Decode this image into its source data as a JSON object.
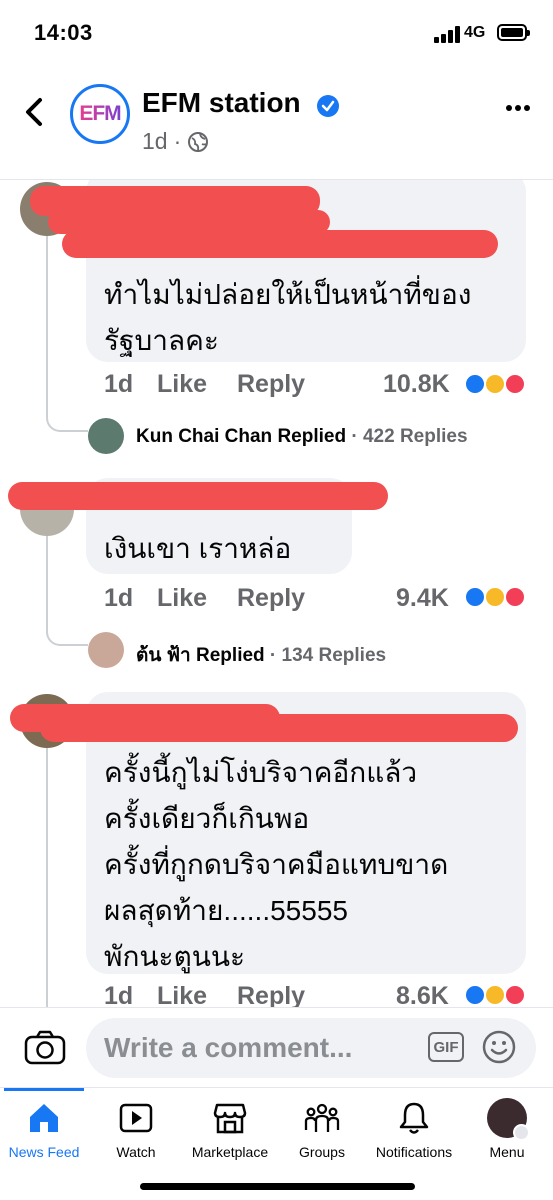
{
  "status_bar": {
    "time": "14:03",
    "network": "4G"
  },
  "header": {
    "page_logo_text": "EFM",
    "page_name": "EFM station",
    "post_age": "1d",
    "separator": "·"
  },
  "comments": [
    {
      "text": "ทำไมไม่ปล่อยให้เป็นหน้าที่ของ\nรัฐบาลคะ",
      "age": "1d",
      "like_label": "Like",
      "reply_label": "Reply",
      "reaction_count": "10.8K",
      "replies": {
        "name": "Kun Chai Chan",
        "replied_label": "Replied",
        "separator": "·",
        "count": "422 Replies"
      }
    },
    {
      "text": "เงินเขา เราหล่อ",
      "age": "1d",
      "like_label": "Like",
      "reply_label": "Reply",
      "reaction_count": "9.4K",
      "replies": {
        "name": "ต้น ฟ้า",
        "replied_label": "Replied",
        "separator": "·",
        "count": "134 Replies"
      }
    },
    {
      "text": "ครั้งนี้กูไม่โง่บริจาคอีกแล้ว\nครั้งเดียวก็เกินพอ\nครั้งที่กูกดบริจาคมือแทบขาด\nผลสุดท้าย......55555\nพักนะตูนนะ",
      "age": "1d",
      "like_label": "Like",
      "reply_label": "Reply",
      "reaction_count": "8.6K"
    }
  ],
  "composer": {
    "placeholder": "Write a comment...",
    "gif_label": "GIF"
  },
  "bottom_nav": {
    "items": [
      {
        "label": "News Feed",
        "icon": "home-icon",
        "active": true
      },
      {
        "label": "Watch",
        "icon": "watch-icon"
      },
      {
        "label": "Marketplace",
        "icon": "marketplace-icon"
      },
      {
        "label": "Groups",
        "icon": "groups-icon"
      },
      {
        "label": "Notifications",
        "icon": "bell-icon"
      },
      {
        "label": "Menu",
        "icon": "menu-avatar-icon"
      }
    ]
  },
  "colors": {
    "accent": "#1877f2",
    "bubble": "#f0f2f5",
    "muted_text": "#65676b",
    "redaction": "#f25050",
    "reaction_like": "#1877f2",
    "reaction_haha": "#f7b928",
    "reaction_love": "#f33e58"
  }
}
